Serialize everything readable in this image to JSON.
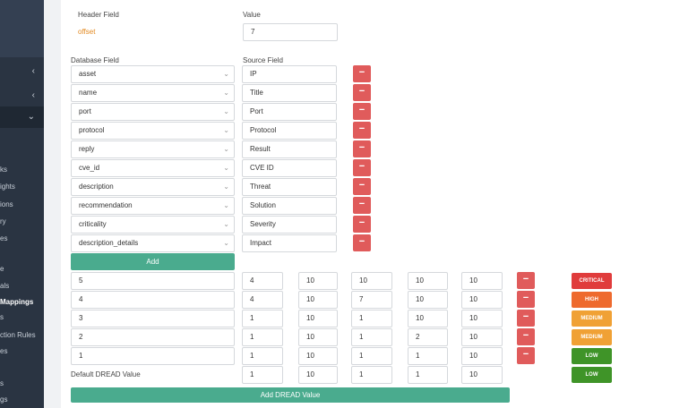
{
  "sidebar": {
    "items": [
      {
        "label": "",
        "active": false
      },
      {
        "label": "",
        "active": false
      },
      {
        "label": "ks",
        "active": false
      },
      {
        "label": "ights",
        "active": false
      },
      {
        "label": "ions",
        "active": false
      },
      {
        "label": "ry",
        "active": false
      },
      {
        "label": "es",
        "active": false
      },
      {
        "label": "e",
        "active": false
      },
      {
        "label": "als",
        "active": false
      },
      {
        "label": "Mappings",
        "active": true
      },
      {
        "label": "s",
        "active": false
      },
      {
        "label": "ction Rules",
        "active": false
      },
      {
        "label": "es",
        "active": false
      },
      {
        "label": "s",
        "active": false
      },
      {
        "label": "gs",
        "active": false
      }
    ]
  },
  "header": {
    "header_field_label": "Header Field",
    "value_label": "Value",
    "header_field_value": "offset",
    "value_value": "7"
  },
  "mapping": {
    "database_field_label": "Database Field",
    "source_field_label": "Source Field",
    "rows": [
      {
        "db": "asset",
        "src": "IP"
      },
      {
        "db": "name",
        "src": "Title"
      },
      {
        "db": "port",
        "src": "Port"
      },
      {
        "db": "protocol",
        "src": "Protocol"
      },
      {
        "db": "reply",
        "src": "Result"
      },
      {
        "db": "cve_id",
        "src": "CVE ID"
      },
      {
        "db": "description",
        "src": "Threat"
      },
      {
        "db": "recommendation",
        "src": "Solution"
      },
      {
        "db": "criticality",
        "src": "Severity"
      },
      {
        "db": "description_details",
        "src": "Impact"
      }
    ],
    "remove_symbol": "−",
    "add_label": "Add"
  },
  "dread": {
    "rows": [
      {
        "value": "5",
        "d": "4",
        "r": "10",
        "e": "10",
        "a": "10",
        "di": "10",
        "badge": "CRITICAL",
        "color": "#e03c3c"
      },
      {
        "value": "4",
        "d": "4",
        "r": "10",
        "e": "7",
        "a": "10",
        "di": "10",
        "badge": "HIGH",
        "color": "#ee6a2e"
      },
      {
        "value": "3",
        "d": "1",
        "r": "10",
        "e": "1",
        "a": "10",
        "di": "10",
        "badge": "MEDIUM",
        "color": "#f0a135"
      },
      {
        "value": "2",
        "d": "1",
        "r": "10",
        "e": "1",
        "a": "2",
        "di": "10",
        "badge": "MEDIUM",
        "color": "#f0a135"
      },
      {
        "value": "1",
        "d": "1",
        "r": "10",
        "e": "1",
        "a": "1",
        "di": "10",
        "badge": "LOW",
        "color": "#3f9428"
      }
    ],
    "default_label": "Default DREAD Value",
    "default_row": {
      "d": "1",
      "r": "10",
      "e": "1",
      "a": "1",
      "di": "10",
      "badge": "LOW",
      "color": "#3f9428"
    },
    "add_label": "Add DREAD Value"
  }
}
